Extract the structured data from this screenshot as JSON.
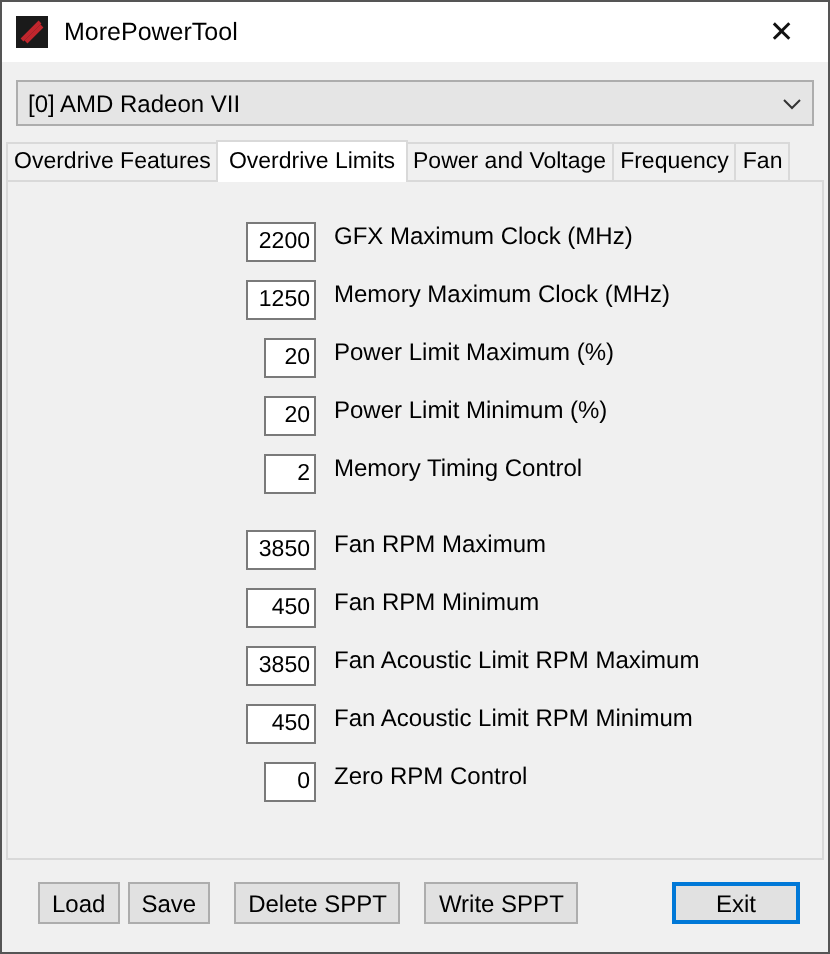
{
  "window": {
    "title": "MorePowerTool",
    "close": "✕"
  },
  "device_select": {
    "value": "[0] AMD Radeon VII"
  },
  "tabs": [
    {
      "label": "Overdrive Features",
      "selected": false
    },
    {
      "label": "Overdrive Limits",
      "selected": true
    },
    {
      "label": "Power and Voltage",
      "selected": false
    },
    {
      "label": "Frequency",
      "selected": false
    },
    {
      "label": "Fan",
      "selected": false
    }
  ],
  "groups": [
    [
      {
        "value": "2200",
        "label": "GFX Maximum Clock (MHz)",
        "kind": "wide"
      },
      {
        "value": "1250",
        "label": "Memory Maximum Clock (MHz)",
        "kind": "wide"
      },
      {
        "value": "20",
        "label": "Power Limit Maximum (%)",
        "kind": "narrow"
      },
      {
        "value": "20",
        "label": "Power Limit Minimum (%)",
        "kind": "narrow"
      },
      {
        "value": "2",
        "label": "Memory Timing Control",
        "kind": "narrow"
      }
    ],
    [
      {
        "value": "3850",
        "label": "Fan RPM Maximum",
        "kind": "wide"
      },
      {
        "value": "450",
        "label": "Fan RPM Minimum",
        "kind": "wide"
      },
      {
        "value": "3850",
        "label": "Fan Acoustic Limit RPM Maximum",
        "kind": "wide"
      },
      {
        "value": "450",
        "label": "Fan Acoustic Limit RPM Minimum",
        "kind": "wide"
      },
      {
        "value": "0",
        "label": "Zero RPM Control",
        "kind": "narrow"
      }
    ]
  ],
  "buttons": [
    {
      "label": "Load",
      "default": false
    },
    {
      "label": "Save",
      "default": false
    },
    {
      "label": "Delete SPPT",
      "default": false
    },
    {
      "label": "Write SPPT",
      "default": false
    },
    {
      "label": "Exit",
      "default": true
    }
  ]
}
